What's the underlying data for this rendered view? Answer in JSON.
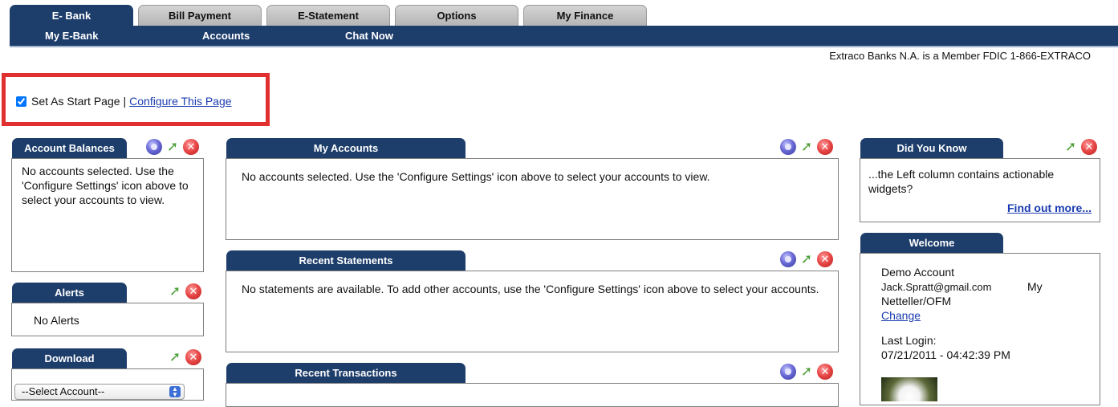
{
  "tabs": [
    {
      "label": "E- Bank"
    },
    {
      "label": "Bill Payment"
    },
    {
      "label": "E-Statement"
    },
    {
      "label": "Options"
    },
    {
      "label": "My Finance"
    }
  ],
  "subnav": [
    {
      "label": "My E-Bank"
    },
    {
      "label": "Accounts"
    },
    {
      "label": "Chat Now"
    }
  ],
  "fdic_notice": "Extraco Banks N.A. is a Member FDIC 1-866-EXTRACO",
  "start_page": {
    "checkbox_label": "Set As Start Page",
    "separator": "|",
    "configure_link": "Configure This Page",
    "checked": true
  },
  "widgets": {
    "account_balances": {
      "title": "Account Balances",
      "body": "No accounts selected. Use the 'Configure Settings' icon above to select your accounts to view."
    },
    "alerts": {
      "title": "Alerts",
      "body": "No Alerts"
    },
    "download": {
      "title": "Download",
      "select_value": "--Select Account--"
    },
    "my_accounts": {
      "title": "My Accounts",
      "body": "No accounts selected. Use the 'Configure Settings' icon above to select your accounts to view."
    },
    "recent_statements": {
      "title": "Recent Statements",
      "body": "No statements are available. To add other accounts, use the 'Configure Settings' icon above to select your accounts."
    },
    "recent_transactions": {
      "title": "Recent Transactions"
    },
    "did_you_know": {
      "title": "Did You Know",
      "body": "...the Left column contains actionable widgets?",
      "link": "Find out more..."
    },
    "welcome": {
      "title": "Welcome",
      "account_name": "Demo Account",
      "email": "Jack.Spratt@gmail.com",
      "profile_text_1": "My",
      "profile_text_2": "Netteller/OFM",
      "change_link": "Change",
      "last_login_label": "Last Login:",
      "last_login_value": "07/21/2011 - 04:42:39 PM"
    }
  },
  "icons": {
    "configure": "gear-icon",
    "expand": "arrow-icon",
    "close": "close-icon"
  },
  "colors": {
    "navy": "#1d3d6b",
    "highlight_border": "#e0302f",
    "link": "#1a3bb0"
  }
}
